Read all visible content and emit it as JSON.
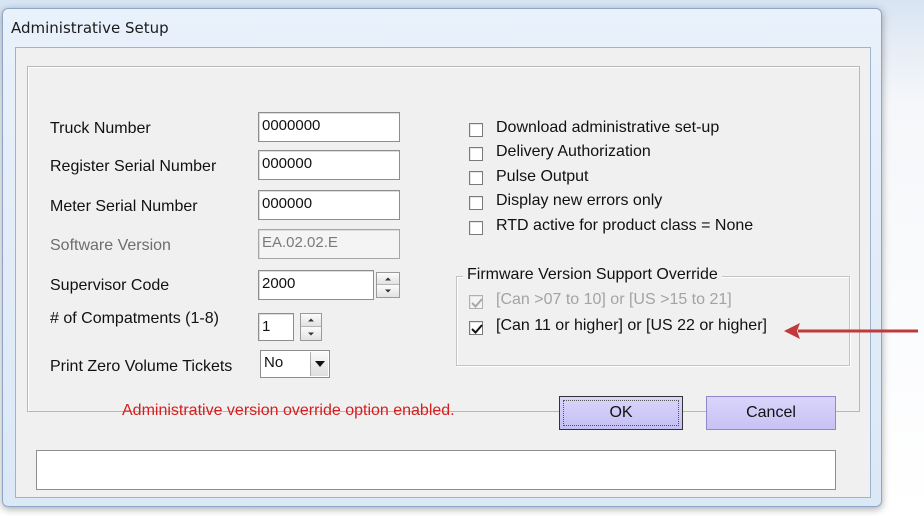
{
  "window": {
    "title": "Administrative Setup"
  },
  "fields": {
    "truck_number": {
      "label": "Truck Number",
      "value": "0000000"
    },
    "register_serial": {
      "label": "Register Serial Number",
      "value": "000000"
    },
    "meter_serial": {
      "label": "Meter Serial Number",
      "value": "000000"
    },
    "software_version": {
      "label": "Software Version",
      "value": "EA.02.02.E"
    },
    "supervisor_code": {
      "label": "Supervisor Code",
      "value": "2000"
    },
    "compartments": {
      "label": "# of Compatments (1-8)",
      "value": "1"
    },
    "print_zero": {
      "label": "Print Zero Volume Tickets",
      "value": "No"
    }
  },
  "options": [
    {
      "label": "Download administrative set-up",
      "checked": false
    },
    {
      "label": "Delivery Authorization",
      "checked": false
    },
    {
      "label": "Pulse Output",
      "checked": false
    },
    {
      "label": "Display new errors only",
      "checked": false
    },
    {
      "label": "RTD active for product class = None",
      "checked": false
    }
  ],
  "firmware_override": {
    "legend": "Firmware Version Support Override",
    "options": [
      {
        "label": "[Can >07 to 10] or [US >15 to 21]",
        "checked": true,
        "disabled": true
      },
      {
        "label": "[Can 11 or higher] or [US 22 or higher]",
        "checked": true,
        "disabled": false
      }
    ]
  },
  "status_message": "Administrative version override option enabled.",
  "buttons": {
    "ok": "OK",
    "cancel": "Cancel"
  },
  "status_bar": {
    "text": ""
  },
  "colors": {
    "status_message": "#d31f1f",
    "button_fill": "#ccc7f6",
    "annotation_arrow": "#c0393b"
  },
  "icons": {
    "annotation": "red-arrow-icon"
  }
}
